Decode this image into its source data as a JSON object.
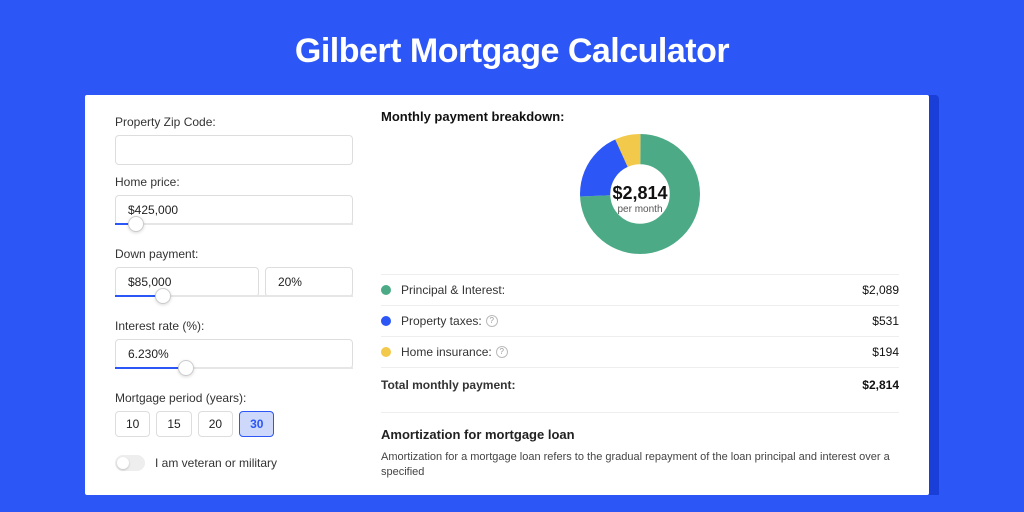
{
  "title": "Gilbert Mortgage Calculator",
  "form": {
    "zip_label": "Property Zip Code:",
    "zip_value": "",
    "home_price_label": "Home price:",
    "home_price_value": "$425,000",
    "home_price_slider_pct": 9,
    "down_payment_label": "Down payment:",
    "down_payment_value": "$85,000",
    "down_payment_pct_value": "20%",
    "down_payment_slider_pct": 20,
    "interest_label": "Interest rate (%):",
    "interest_value": "6.230%",
    "interest_slider_pct": 30,
    "period_label": "Mortgage period (years):",
    "periods": [
      "10",
      "15",
      "20",
      "30"
    ],
    "period_selected": "30",
    "veteran_label": "I am veteran or military",
    "veteran_on": false
  },
  "breakdown": {
    "title": "Monthly payment breakdown:",
    "center_amount": "$2,814",
    "center_sub": "per month",
    "items": [
      {
        "label": "Principal & Interest:",
        "value": "$2,089",
        "color": "#4cab86",
        "num": 2089,
        "info": false
      },
      {
        "label": "Property taxes:",
        "value": "$531",
        "color": "#2c56f6",
        "num": 531,
        "info": true
      },
      {
        "label": "Home insurance:",
        "value": "$194",
        "color": "#f3c94c",
        "num": 194,
        "info": true
      }
    ],
    "total_label": "Total monthly payment:",
    "total_value": "$2,814"
  },
  "amortization": {
    "title": "Amortization for mortgage loan",
    "text": "Amortization for a mortgage loan refers to the gradual repayment of the loan principal and interest over a specified"
  },
  "chart_data": {
    "type": "pie",
    "title": "Monthly payment breakdown",
    "series": [
      {
        "name": "Principal & Interest",
        "value": 2089,
        "color": "#4cab86"
      },
      {
        "name": "Property taxes",
        "value": 531,
        "color": "#2c56f6"
      },
      {
        "name": "Home insurance",
        "value": 194,
        "color": "#f3c94c"
      }
    ],
    "total": 2814,
    "center_label": "$2,814 per month"
  }
}
